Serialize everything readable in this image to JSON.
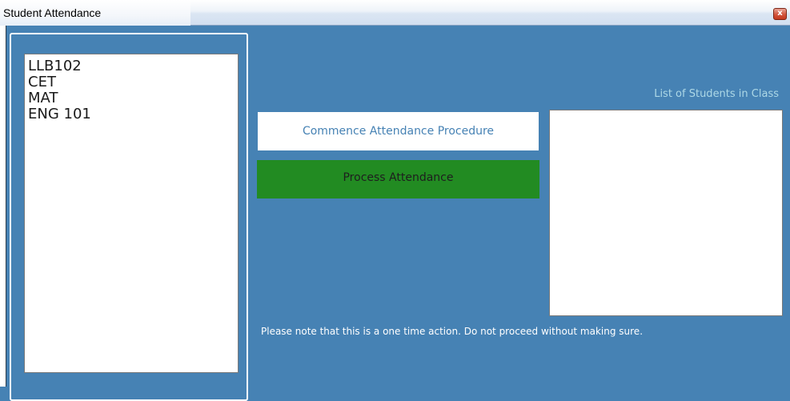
{
  "window": {
    "title": "Student Attendance",
    "close_glyph": "x"
  },
  "courses": {
    "items": [
      "LLB102",
      "CET",
      "MAT",
      "ENG 101"
    ]
  },
  "students": {
    "title": "List of Students in Class",
    "items": []
  },
  "buttons": {
    "commence_label": "Commence Attendance Procedure",
    "process_label": "Process Attendance"
  },
  "notice": "Please note that this is a one time action. Do not proceed without making sure.",
  "colors": {
    "background": "#4682b4",
    "process_button": "#228b22",
    "list_title": "#add8e6",
    "commence_text": "#4682b4"
  },
  "icons": {
    "close": "close-icon"
  }
}
